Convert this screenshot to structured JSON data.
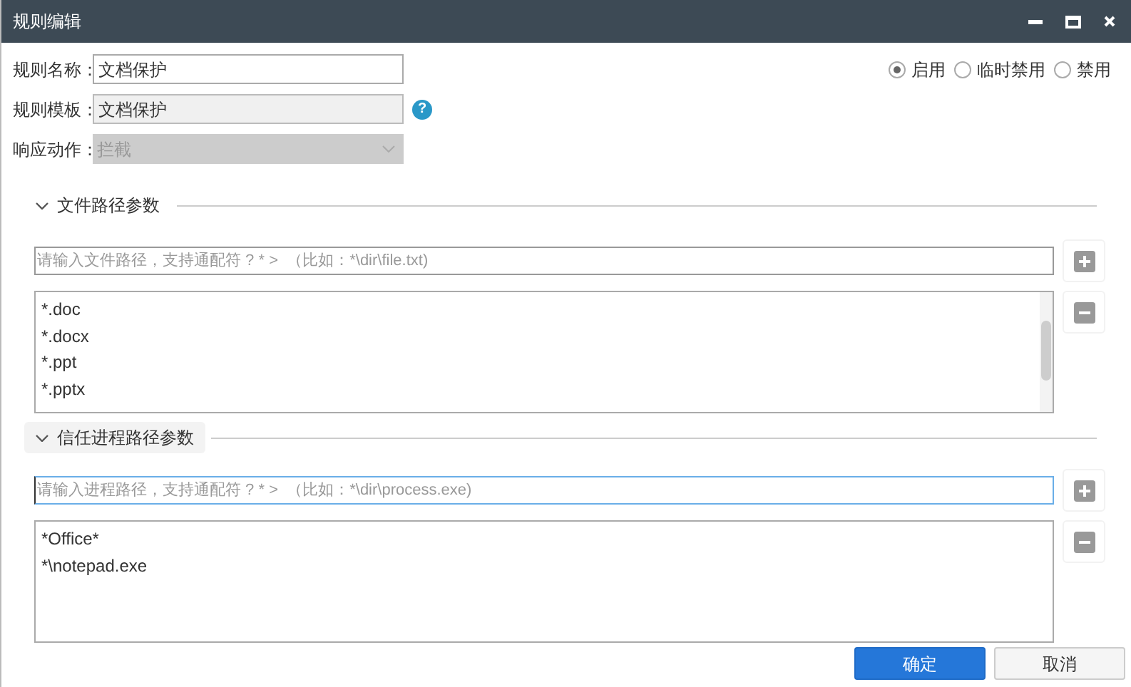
{
  "window": {
    "title": "规则编辑"
  },
  "fields": [
    {
      "label": "规则名称：",
      "value": "文档保护",
      "kind": "text"
    },
    {
      "label": "规则模板：",
      "value": "文档保护",
      "kind": "readonly",
      "help": "?"
    },
    {
      "label": "响应动作：",
      "value": "拦截",
      "kind": "select"
    }
  ],
  "status_options": [
    {
      "label": "启用",
      "selected": true
    },
    {
      "label": "临时禁用",
      "selected": false
    },
    {
      "label": "禁用",
      "selected": false
    }
  ],
  "sections": [
    {
      "title": "文件路径参数",
      "expanded": true,
      "hovered": false,
      "input": {
        "placeholder": "请输入文件路径，支持通配符 ? * >  （比如：*\\dir\\file.txt)",
        "focused": false
      },
      "items": [
        "*.doc",
        "*.docx",
        "*.ppt",
        "*.pptx"
      ],
      "scrollbar": true
    },
    {
      "title": "信任进程路径参数",
      "expanded": true,
      "hovered": true,
      "input": {
        "placeholder": "请输入进程路径，支持通配符 ? * >  （比如：*\\dir\\process.exe)",
        "focused": true
      },
      "items": [
        "*Office*",
        "*\\notepad.exe"
      ],
      "scrollbar": false
    }
  ],
  "buttons": [
    {
      "label": "确定",
      "kind": "primary"
    },
    {
      "label": "取消",
      "kind": "default"
    }
  ]
}
